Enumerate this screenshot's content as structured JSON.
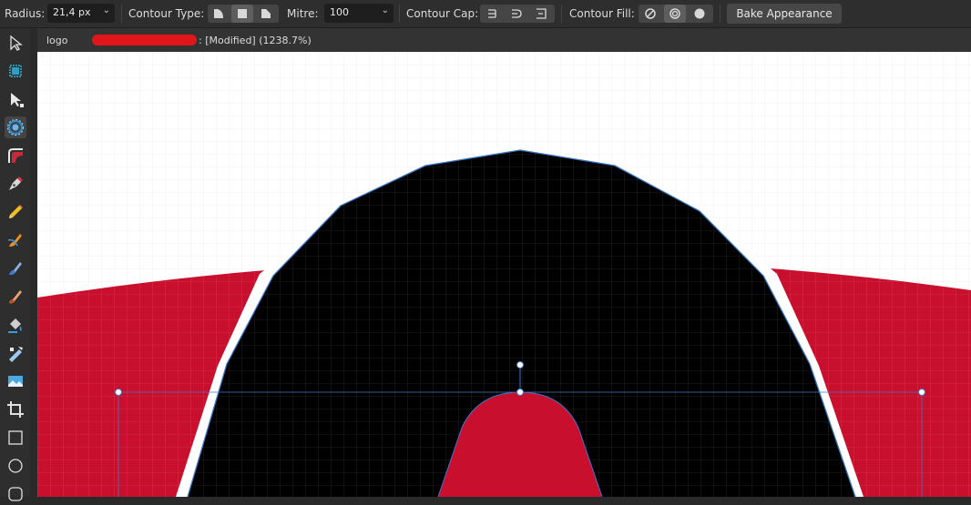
{
  "context_toolbar": {
    "radius_label": "Radius:",
    "radius_value": "21,4 px",
    "contour_type_label": "Contour Type:",
    "mitre_label": "Mitre:",
    "mitre_value": "100",
    "contour_cap_label": "Contour Cap:",
    "contour_fill_label": "Contour Fill:",
    "bake_label": "Bake Appearance"
  },
  "document_tab": {
    "name": "logo",
    "status": ": [Modified] (1238.7%)"
  },
  "tools": [
    {
      "name": "move-tool",
      "icon": "arrow-icon"
    },
    {
      "name": "artboard-tool",
      "icon": "artboard-icon"
    },
    {
      "name": "node-tool",
      "icon": "node-arrow-icon"
    },
    {
      "name": "contour-tool",
      "icon": "contour-icon",
      "active": true
    },
    {
      "name": "corner-tool",
      "icon": "corner-icon"
    },
    {
      "name": "pen-tool",
      "icon": "pen-nib-icon"
    },
    {
      "name": "pencil-tool",
      "icon": "pencil-icon"
    },
    {
      "name": "vector-brush-tool",
      "icon": "vector-brush-icon"
    },
    {
      "name": "fill-tool",
      "icon": "fill-brush-icon"
    },
    {
      "name": "paint-brush-tool",
      "icon": "paint-brush-icon"
    },
    {
      "name": "vector-flood-fill-tool",
      "icon": "paint-bucket-icon"
    },
    {
      "name": "transparency-tool",
      "icon": "transparency-icon"
    },
    {
      "name": "place-image-tool",
      "icon": "image-icon"
    },
    {
      "name": "crop-tool",
      "icon": "crop-icon"
    },
    {
      "name": "rectangle-tool",
      "icon": "rectangle-icon"
    },
    {
      "name": "ellipse-tool",
      "icon": "ellipse-icon"
    },
    {
      "name": "rounded-rectangle-tool",
      "icon": "rounded-rectangle-icon"
    }
  ],
  "colors": {
    "red": "#c8102e",
    "black": "#000000",
    "selection_blue": "#3b78c8",
    "canvas": "#ffffff",
    "ui_dark": "#2e2e2e"
  }
}
